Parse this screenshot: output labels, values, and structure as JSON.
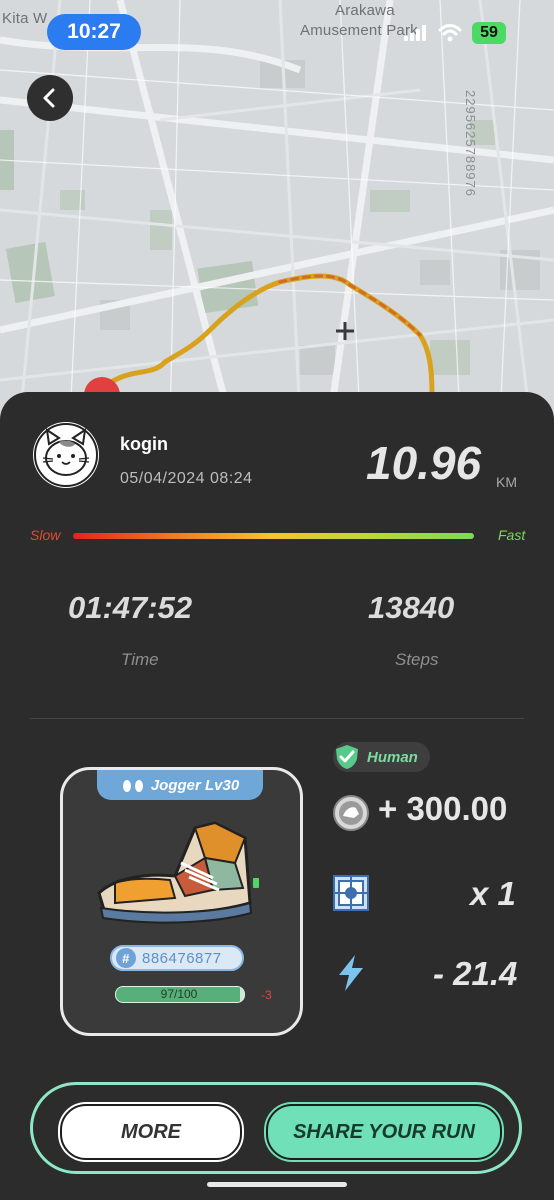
{
  "status_bar": {
    "time": "10:27",
    "battery": "59"
  },
  "map": {
    "label_kita": "Kita W",
    "label_line1": "Arakawa",
    "label_line2": "Amusement Park",
    "watermark_id": "2295625788976"
  },
  "run": {
    "username": "kogin",
    "datetime": "05/04/2024 08:24",
    "distance": "10.96",
    "distance_unit": "KM",
    "speed_slow": "Slow",
    "speed_fast": "Fast",
    "time_value": "01:47:52",
    "time_label": "Time",
    "steps_value": "13840",
    "steps_label": "Steps"
  },
  "shoe": {
    "level": "Jogger Lv30",
    "id": "886476877",
    "durability_text": "97/100",
    "durability": 0.97,
    "durability_delta": "-3"
  },
  "rewards": {
    "human_badge": "Human",
    "gst_amount": "+ 300.00",
    "box_count": "x 1",
    "energy_amount": "- 21.4"
  },
  "actions": {
    "more_label": "MORE",
    "share_label": "SHARE YOUR RUN"
  },
  "colors": {
    "accent_green": "#6fe0b8",
    "shoe_blue": "#6fa8d8",
    "slow_red": "#e34a33",
    "fast_green": "#7ed957"
  },
  "icons": {
    "back": "chevron-left-icon",
    "signal": "signal-icon",
    "wifi": "wifi-icon",
    "gst": "gst-token-icon",
    "box": "mystery-box-icon",
    "energy": "lightning-icon",
    "verified": "shield-check-icon"
  }
}
